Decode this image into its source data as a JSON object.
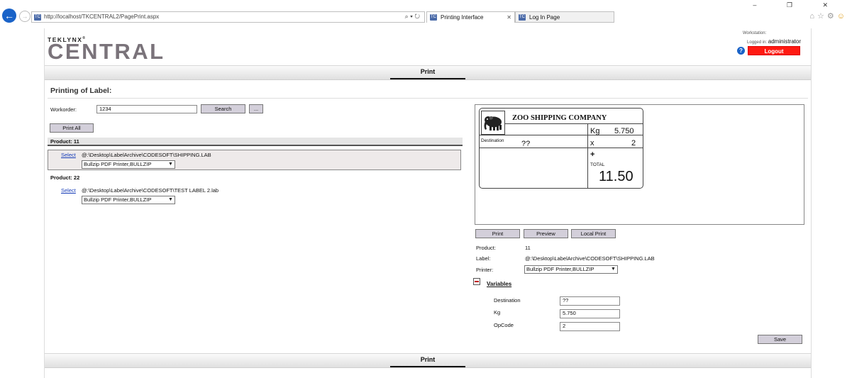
{
  "browser": {
    "url": "http://localhost/TKCENTRAL2/PagePrint.aspx",
    "favicon_text": "TC",
    "address_controls": "⌕ ▾ ↻",
    "tabs": [
      {
        "label": "Printing Interface",
        "close": "✕"
      },
      {
        "label": "Log In Page"
      }
    ],
    "window_controls": "–  ❐  ✕",
    "toolbar_icons": [
      "home-icon",
      "star-icon",
      "gear-icon",
      "smiley-icon"
    ]
  },
  "header": {
    "logo_top": "TEKLYNX",
    "logo_reg": "®",
    "logo_main": "CENTRAL",
    "workstation_label": "Workstation:",
    "logged_in_label": "Logged in:",
    "user": "administrator",
    "help": "?",
    "logout_label": "Logout",
    "logout_color": "#ff1a12"
  },
  "nav": {
    "tab_label": "Print"
  },
  "printing": {
    "title": "Printing of Label:",
    "workorder_label": "Workorder:",
    "workorder_value": "1234",
    "search_label": "Search",
    "browse_label": "...",
    "print_all_label": "Print All",
    "products": [
      {
        "header": "Product:  11",
        "select_label": "Select",
        "path": "@:\\Desktop\\LabelArchive\\CODESOFT\\SHIPPING.LAB",
        "printer": "Bullzip PDF Printer,BULLZIP"
      },
      {
        "header": "Product:  22",
        "select_label": "Select",
        "path": "@:\\Desktop\\LabelArchive\\CODESOFT\\TEST LABEL 2.lab",
        "printer": "Bullzip PDF Printer,BULLZIP"
      }
    ]
  },
  "preview": {
    "company": "ZOO SHIPPING COMPANY",
    "kg_label": "Kg",
    "kg_value": "5.750",
    "x_label": "x",
    "x_value": "2",
    "plus": "+",
    "total_label": "TOTAL",
    "total_value": "11.50",
    "destination_label": "Destination",
    "destination_value": "??"
  },
  "actions": {
    "print_label": "Print",
    "preview_label": "Preview",
    "local_print_label": "Local Print"
  },
  "details": {
    "product_label": "Product:",
    "product_value": "11",
    "label_label": "Label:",
    "label_value": "@:\\Desktop\\LabelArchive\\CODESOFT\\SHIPPING.LAB",
    "printer_label": "Printer:",
    "printer_value": "Bullzip PDF Printer,BULLZIP"
  },
  "variables": {
    "title": "Variables",
    "fields": [
      {
        "label": "Destination",
        "value": "??"
      },
      {
        "label": "Kg",
        "value": "5.750"
      },
      {
        "label": "OpCode",
        "value": "2"
      }
    ],
    "save_label": "Save"
  }
}
